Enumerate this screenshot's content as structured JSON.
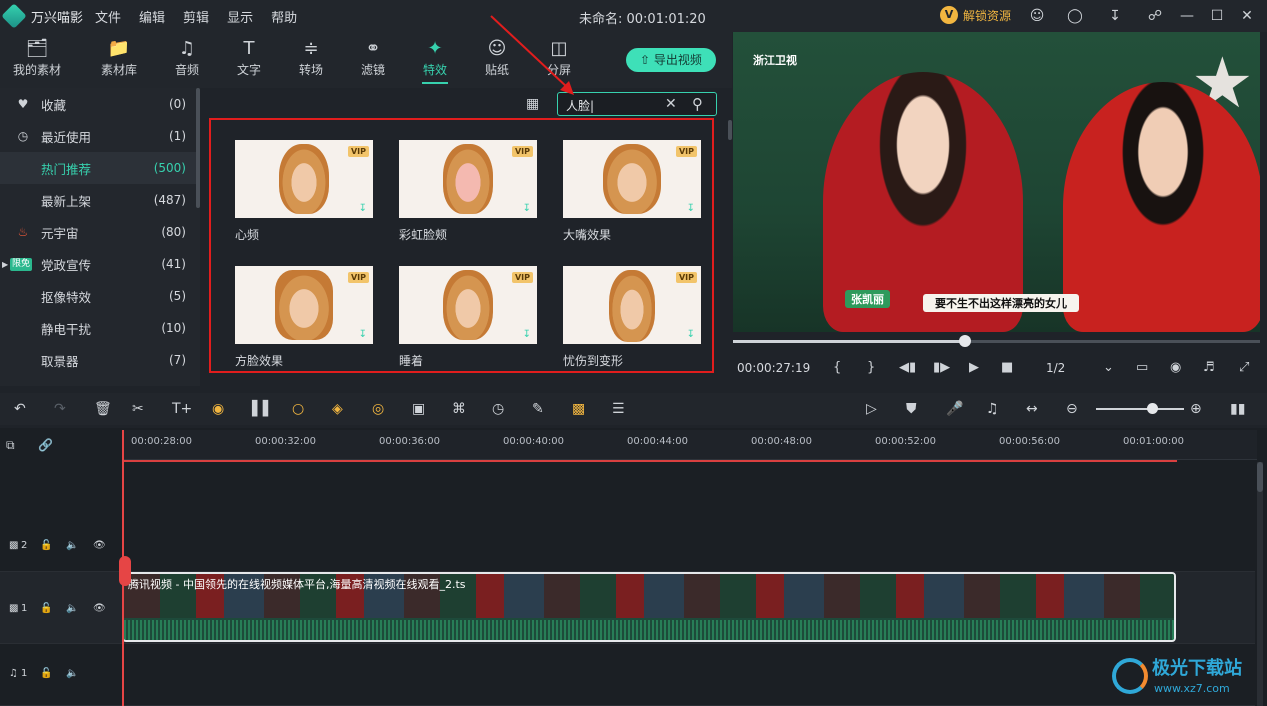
{
  "app": {
    "name": "万兴喵影",
    "window_title": "未命名: 00:01:01:20",
    "unlock_label": "解锁资源",
    "vip_badge": "V"
  },
  "menu": [
    "文件",
    "编辑",
    "剪辑",
    "显示",
    "帮助"
  ],
  "tabs": [
    {
      "label": "我的素材",
      "icon": "folder-box-icon"
    },
    {
      "label": "素材库",
      "icon": "folder-icon"
    },
    {
      "label": "音频",
      "icon": "music-note-icon"
    },
    {
      "label": "文字",
      "icon": "text-t-icon"
    },
    {
      "label": "转场",
      "icon": "transition-icon"
    },
    {
      "label": "滤镜",
      "icon": "filter-circles-icon"
    },
    {
      "label": "特效",
      "icon": "sparkle-wand-icon"
    },
    {
      "label": "贴纸",
      "icon": "smiley-sticker-icon"
    },
    {
      "label": "分屏",
      "icon": "split-screen-icon"
    }
  ],
  "active_tab": "特效",
  "export_label": "导出视频",
  "sidebar": {
    "items": [
      {
        "label": "收藏",
        "count": "(0)",
        "icon": "heart-icon"
      },
      {
        "label": "最近使用",
        "count": "(1)",
        "icon": "clock-icon"
      },
      {
        "label": "热门推荐",
        "count": "(500)",
        "icon": ""
      },
      {
        "label": "最新上架",
        "count": "(487)",
        "icon": ""
      },
      {
        "label": "元宇宙",
        "count": "(80)",
        "icon": "fire-icon"
      },
      {
        "label": "党政宣传",
        "count": "(41)",
        "icon": "limited-badge",
        "badge": "限免"
      },
      {
        "label": "抠像特效",
        "count": "(5)",
        "icon": ""
      },
      {
        "label": "静电干扰",
        "count": "(10)",
        "icon": ""
      },
      {
        "label": "取景器",
        "count": "(7)",
        "icon": ""
      }
    ],
    "active_index": 2
  },
  "search": {
    "value": "人脸|"
  },
  "effects": [
    {
      "label": "心频",
      "vip": "VIP"
    },
    {
      "label": "彩虹脸颊",
      "vip": "VIP"
    },
    {
      "label": "大嘴效果",
      "vip": "VIP"
    },
    {
      "label": "方脸效果",
      "vip": "VIP"
    },
    {
      "label": "睡着",
      "vip": "VIP"
    },
    {
      "label": "忧伤到变形",
      "vip": "VIP"
    }
  ],
  "preview": {
    "channel": "浙江卫视",
    "subtitle_name": "张凯丽",
    "subtitle_text": "要不生不出这样漂亮的女儿",
    "timecode": "00:00:27:19",
    "ratio": "1/2",
    "progress": 0.44
  },
  "timeline": {
    "ticks": [
      "00:00:28:00",
      "00:00:32:00",
      "00:00:36:00",
      "00:00:40:00",
      "00:00:44:00",
      "00:00:48:00",
      "00:00:52:00",
      "00:00:56:00",
      "00:01:00:00"
    ],
    "tracks": [
      {
        "label": "2"
      },
      {
        "label": "1"
      },
      {
        "label": "1"
      }
    ],
    "clip_title": "腾讯视频 - 中国领先的在线视频媒体平台,海量高清视频在线观看_2.ts"
  },
  "watermark": {
    "title": "极光下载站",
    "url": "www.xz7.com"
  },
  "colors": {
    "accent": "#37d1ae",
    "highlight": "#e11d1d",
    "vip": "#f2c46a"
  }
}
